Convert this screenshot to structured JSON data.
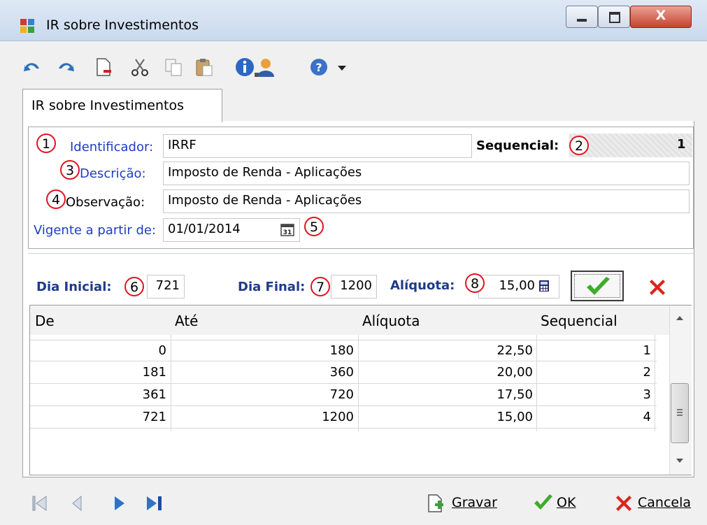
{
  "window": {
    "title": "IR sobre Investimentos",
    "close_label": "X"
  },
  "toolbar": {
    "icons": [
      "undo-icon",
      "redo-icon",
      "new-document-icon",
      "cut-icon",
      "copy-icon",
      "paste-icon",
      "info-icon",
      "user-icon",
      "help-icon",
      "dropdown-arrow-icon"
    ]
  },
  "tab": {
    "label": "IR sobre Investimentos"
  },
  "form": {
    "identificador_label": "Identificador:",
    "identificador_value": "IRRF",
    "sequencial_label": "Sequencial:",
    "sequencial_value": "1",
    "descricao_label": "Descrição:",
    "descricao_value": "Imposto de Renda - Aplicações",
    "observacao_label": "Observação:",
    "observacao_value": "Imposto de Renda - Aplicações",
    "vigente_label": "Vigente a partir de:",
    "vigente_value": "01/01/2014",
    "dia_inicial_label": "Dia Inicial:",
    "dia_inicial_value": "721",
    "dia_final_label": "Dia Final:",
    "dia_final_value": "1200",
    "aliquota_label": "Alíquota:",
    "aliquota_value": "15,00"
  },
  "badges": [
    "1",
    "2",
    "3",
    "4",
    "5",
    "6",
    "7",
    "8"
  ],
  "grid": {
    "columns": [
      "De",
      "Até",
      "Alíquota",
      "Sequencial"
    ],
    "rows": [
      [
        "0",
        "180",
        "22,50",
        "1"
      ],
      [
        "181",
        "360",
        "20,00",
        "2"
      ],
      [
        "361",
        "720",
        "17,50",
        "3"
      ],
      [
        "721",
        "1200",
        "15,00",
        "4"
      ]
    ]
  },
  "footer": {
    "gravar_label": "Gravar",
    "ok_label": "OK",
    "cancela_label": "Cancela"
  },
  "colors": {
    "label_blue": "#1e3cc8",
    "badge_red": "#e0141e",
    "check_green": "#3dac2a",
    "delete_red": "#d9261c"
  }
}
